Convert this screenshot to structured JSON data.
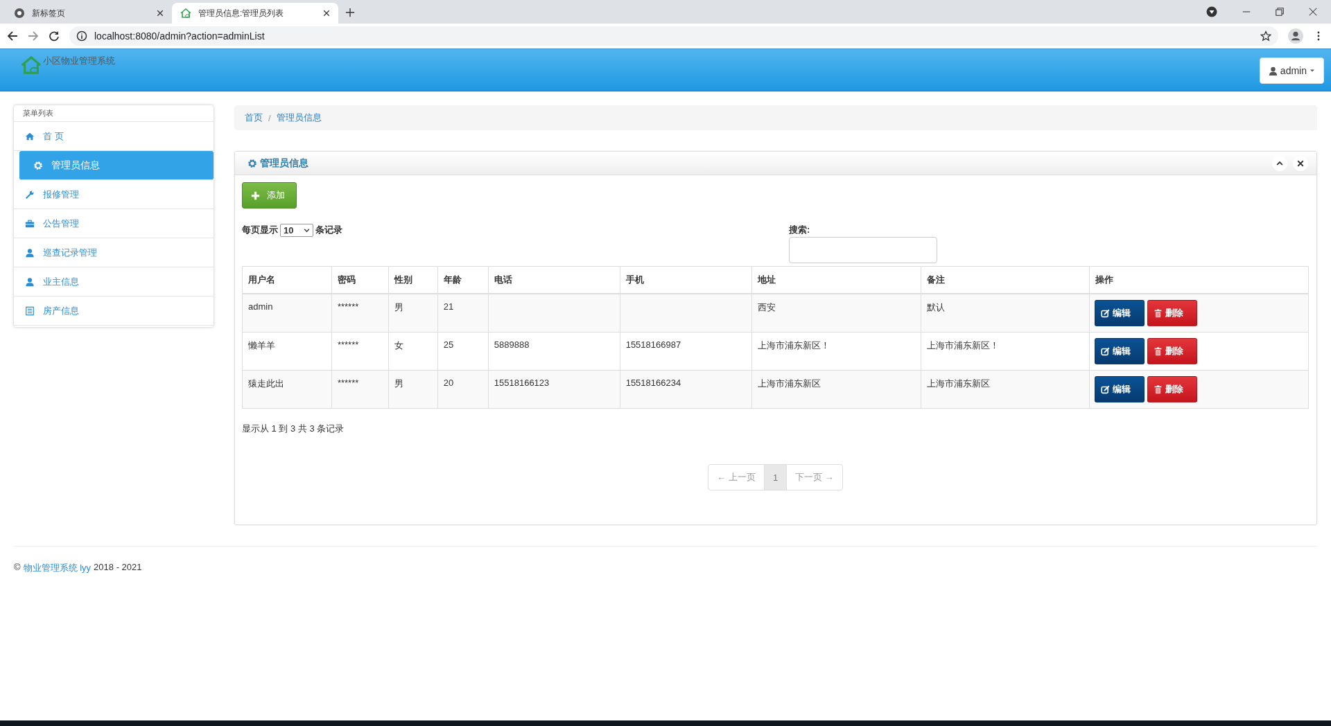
{
  "browser": {
    "tabs": [
      {
        "title": "新标签页",
        "selected": false
      },
      {
        "title": "管理员信息:管理员列表",
        "selected": true
      }
    ],
    "url": "localhost:8080/admin?action=adminList"
  },
  "app": {
    "brand": "小区物业管理系统",
    "user": "admin"
  },
  "sidebar": {
    "heading": "菜单列表",
    "items": [
      {
        "label": "首 页",
        "selected": false
      },
      {
        "label": "管理员信息",
        "selected": true
      },
      {
        "label": "报修管理",
        "selected": false
      },
      {
        "label": "公告管理",
        "selected": false
      },
      {
        "label": "巡查记录管理",
        "selected": false
      },
      {
        "label": "业主信息",
        "selected": false
      },
      {
        "label": "房产信息",
        "selected": false
      }
    ]
  },
  "breadcrumb": {
    "separator": "/",
    "items": [
      "首页",
      "管理员信息"
    ]
  },
  "panel": {
    "title": "管理员信息",
    "add_button": "添加",
    "page_size": {
      "prefix": "每页显示",
      "value": "10",
      "suffix": "条记录"
    },
    "search_label": "搜索:",
    "table": {
      "columns": [
        "用户名",
        "密码",
        "性别",
        "年龄",
        "电话",
        "手机",
        "地址",
        "备注",
        "操作"
      ],
      "rows": [
        {
          "cells": [
            "admin",
            "******",
            "男",
            "21",
            "",
            "",
            "西安",
            "默认"
          ],
          "actions": [
            {
              "kind": "edit",
              "label": "编辑"
            },
            {
              "kind": "delete",
              "label": "删除"
            }
          ]
        },
        {
          "cells": [
            "懒羊羊",
            "******",
            "女",
            "25",
            "5889888",
            "15518166987",
            "上海市浦东新区！",
            "上海市浦东新区！"
          ],
          "actions": [
            {
              "kind": "edit",
              "label": "编辑"
            },
            {
              "kind": "delete",
              "label": "删除"
            }
          ]
        },
        {
          "cells": [
            "猿走此出",
            "******",
            "男",
            "20",
            "15518166123",
            "15518166234",
            "上海市浦东新区",
            "上海市浦东新区"
          ],
          "actions": [
            {
              "kind": "edit",
              "label": "编辑"
            },
            {
              "kind": "delete",
              "label": "删除"
            }
          ]
        }
      ]
    },
    "info": "显示从 1 到 3 共 3 条记录",
    "pagination": [
      {
        "label": "← 上一页",
        "selected": false
      },
      {
        "label": "1",
        "selected": true
      },
      {
        "label": "下一页 →",
        "selected": false
      }
    ]
  },
  "footer": {
    "prefix": "©",
    "link": "物业管理系统 lyy",
    "suffix": "2018 - 2021"
  }
}
